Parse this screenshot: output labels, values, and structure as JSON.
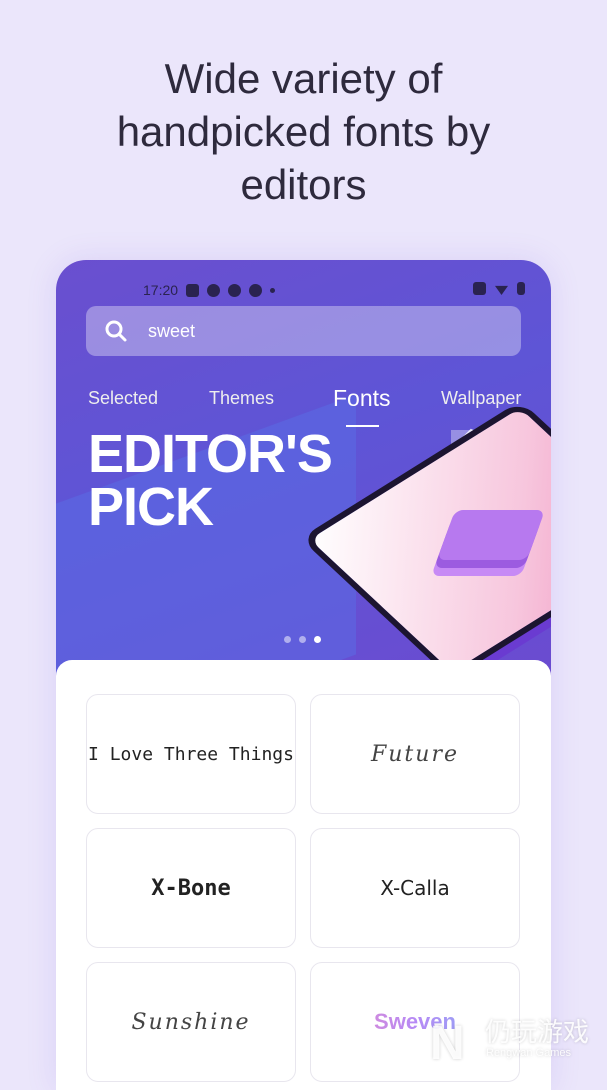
{
  "headline": [
    "Wide variety of",
    "handpicked fonts by",
    "editors"
  ],
  "status_bar": {
    "time": "17:20"
  },
  "search": {
    "value": "sweet"
  },
  "tabs": [
    "Selected",
    "Themes",
    "Fonts",
    "Wallpaper"
  ],
  "active_tab": "Fonts",
  "banner": {
    "line1": "EDITOR'S",
    "line2": "PICK",
    "page_dots": 3,
    "active_dot": 3
  },
  "fonts": [
    "I Love Three Things",
    "Future",
    "X-Bone",
    "X-Calla",
    "Sunshine",
    "Sweven"
  ],
  "watermark": {
    "cn": "仍玩游戏",
    "en": "Rengwan Games"
  },
  "colors": {
    "background": "#ebe6fb",
    "banner": "#6a4fcf",
    "accent": "#ffffff"
  }
}
